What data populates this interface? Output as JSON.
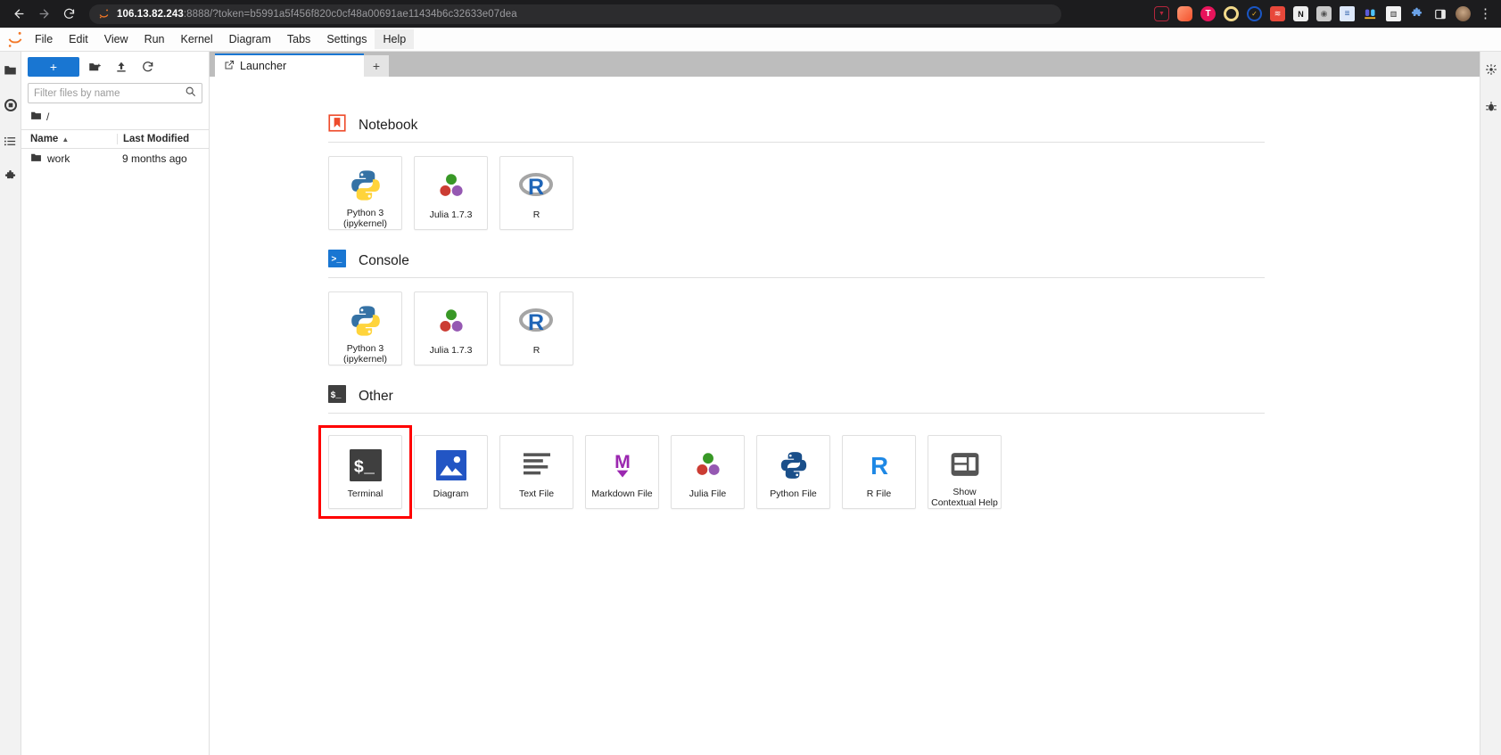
{
  "browser": {
    "back_icon": "back-arrow-icon",
    "forward_icon": "forward-arrow-icon",
    "reload_icon": "reload-icon",
    "url_host": "106.13.82.243",
    "url_rest": ":8888/?token=b5991a5f456f820c0cf48a00691ae11434b6c32633e07dea",
    "url_full": "106.13.82.243:8888/?token=b5991a5f456f820c0cf48a00691ae11434b6c32633e07dea",
    "extensions": [
      {
        "name": "pocket-icon",
        "color": "#a32035",
        "glyph": "▼"
      },
      {
        "name": "peach-circle-icon",
        "color": "#f4714f",
        "glyph": ""
      },
      {
        "name": "tampermonkey-icon",
        "color": "#e8145b",
        "glyph": "T"
      },
      {
        "name": "ring-circle-icon",
        "color": "#f2d98a",
        "glyph": ""
      },
      {
        "name": "checkmark-badge-icon",
        "color": "#1a56c4",
        "glyph": "✓"
      },
      {
        "name": "rss-feed-icon",
        "color": "#e8483a",
        "glyph": "◠"
      },
      {
        "name": "notion-icon",
        "color": "#f0f0f0",
        "glyph": "N"
      },
      {
        "name": "camera-icon",
        "color": "#cfcfcf",
        "glyph": "◉"
      },
      {
        "name": "lines-panel-icon",
        "color": "#e9eef8",
        "glyph": "≡"
      },
      {
        "name": "people-icon",
        "color": "#5b5bd6",
        "glyph": ""
      },
      {
        "name": "barcode-icon",
        "color": "#f5f5f5",
        "glyph": "▐"
      },
      {
        "name": "puzzle-extension-icon",
        "color": "#5c8dd6",
        "glyph": "✦"
      },
      {
        "name": "sidepanel-icon",
        "color": "#fdfdfd",
        "glyph": "▯"
      },
      {
        "name": "profile-avatar-icon",
        "color": "#8a6a4a",
        "glyph": "●"
      }
    ],
    "menu_kebab": "⋮"
  },
  "menubar": {
    "logo": "jupyter-logo-icon",
    "items": [
      {
        "label": "File",
        "active": false
      },
      {
        "label": "Edit",
        "active": false
      },
      {
        "label": "View",
        "active": false
      },
      {
        "label": "Run",
        "active": false
      },
      {
        "label": "Kernel",
        "active": false
      },
      {
        "label": "Diagram",
        "active": false
      },
      {
        "label": "Tabs",
        "active": false
      },
      {
        "label": "Settings",
        "active": false
      },
      {
        "label": "Help",
        "active": true
      }
    ]
  },
  "activity_bar": {
    "items": [
      {
        "name": "file-browser-icon",
        "selected": true
      },
      {
        "name": "running-terminals-icon",
        "selected": false
      },
      {
        "name": "table-of-contents-icon",
        "selected": false
      },
      {
        "name": "extension-manager-icon",
        "selected": false
      }
    ]
  },
  "right_bar": {
    "items": [
      {
        "name": "property-inspector-icon"
      },
      {
        "name": "debugger-icon"
      }
    ]
  },
  "file_browser": {
    "new_launcher_label": "+",
    "new_folder_icon": "new-folder-icon",
    "upload_icon": "upload-icon",
    "refresh_icon": "refresh-icon",
    "filter_value": "",
    "filter_placeholder": "Filter files by name",
    "search_icon": "search-icon",
    "breadcrumb_root": "/",
    "breadcrumb_icon": "folder-icon",
    "columns": {
      "name": "Name",
      "last_modified": "Last Modified",
      "sort_caret": "▲"
    },
    "rows": [
      {
        "name": "work",
        "modified": "9 months ago",
        "icon": "folder-icon"
      }
    ]
  },
  "tabbar": {
    "tabs": [
      {
        "label": "Launcher",
        "icon": "launcher-icon",
        "active": true
      }
    ],
    "add_tab_label": "+"
  },
  "launcher": {
    "sections": [
      {
        "title": "Notebook",
        "icon": "notebook-bookmark-icon",
        "cards": [
          {
            "label": "Python 3\n(ipykernel)",
            "icon": "python-logo-icon",
            "highlight": false
          },
          {
            "label": "Julia 1.7.3",
            "icon": "julia-logo-icon",
            "highlight": false
          },
          {
            "label": "R",
            "icon": "r-logo-icon",
            "highlight": false
          }
        ]
      },
      {
        "title": "Console",
        "icon": "console-prompt-icon",
        "cards": [
          {
            "label": "Python 3\n(ipykernel)",
            "icon": "python-logo-icon",
            "highlight": false
          },
          {
            "label": "Julia 1.7.3",
            "icon": "julia-logo-icon",
            "highlight": false
          },
          {
            "label": "R",
            "icon": "r-logo-icon",
            "highlight": false
          }
        ]
      },
      {
        "title": "Other",
        "icon": "terminal-dollar-icon",
        "cards": [
          {
            "label": "Terminal",
            "icon": "terminal-dollar-icon",
            "highlight": true
          },
          {
            "label": "Diagram",
            "icon": "diagram-image-icon",
            "highlight": false
          },
          {
            "label": "Text File",
            "icon": "text-lines-icon",
            "highlight": false
          },
          {
            "label": "Markdown File",
            "icon": "markdown-m-icon",
            "highlight": false
          },
          {
            "label": "Julia File",
            "icon": "julia-logo-icon",
            "highlight": false
          },
          {
            "label": "Python File",
            "icon": "python-file-icon",
            "highlight": false
          },
          {
            "label": "R File",
            "icon": "r-letter-icon",
            "highlight": false
          },
          {
            "label": "Show\nContextual Help",
            "icon": "contextual-help-panel-icon",
            "highlight": false
          }
        ]
      }
    ]
  },
  "colors": {
    "accent_blue": "#1976d2",
    "highlight_red": "#ff0000",
    "jupyter_orange": "#f37726",
    "tabbar_gray": "#bdbdbd"
  }
}
